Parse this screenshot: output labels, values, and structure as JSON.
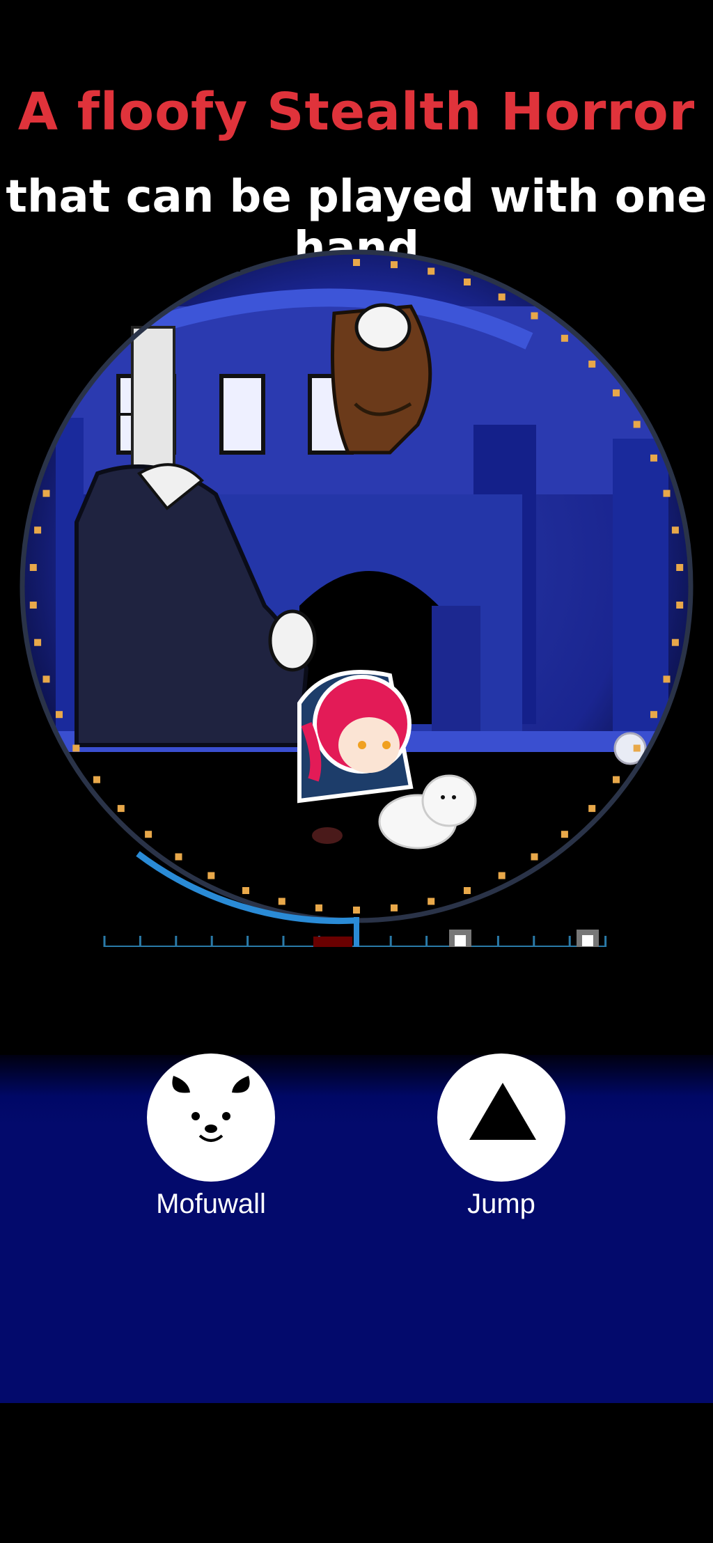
{
  "headline": {
    "title": "A floofy Stealth Horror",
    "subtitle": "that can be played with one hand"
  },
  "actions": {
    "mofuwall": {
      "label": "Mofuwall",
      "icon": "dog-face-icon"
    },
    "jump": {
      "label": "Jump",
      "icon": "triangle-up-icon"
    }
  },
  "colors": {
    "title": "#e0333b",
    "bottom_panel": "#030a6c",
    "dot": "#e8a84a",
    "gauge": "#2a8bd6",
    "danger_marker": "#d40000"
  }
}
